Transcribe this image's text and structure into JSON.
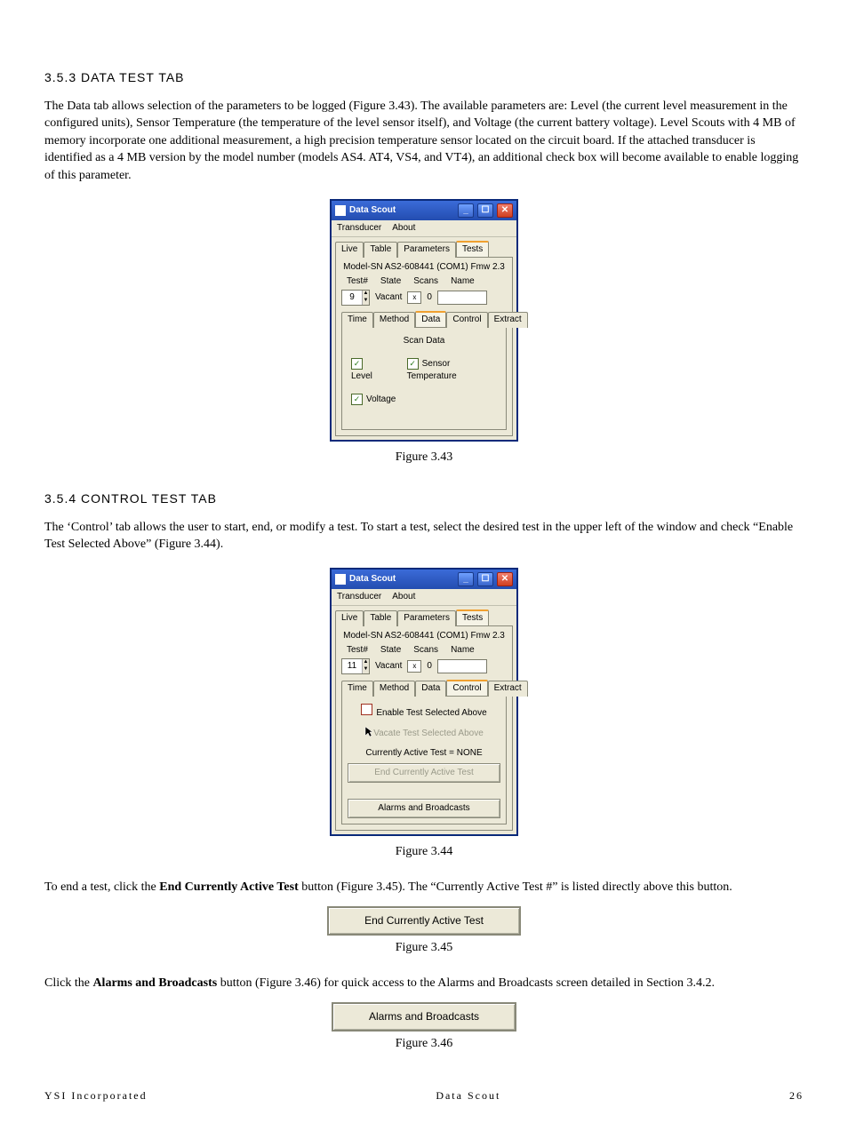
{
  "sections": {
    "s353": {
      "heading": "3.5.3 DATA TEST TAB",
      "para": "The Data tab allows selection of the parameters to be logged (Figure 3.43). The available parameters are: Level (the current level measurement in the configured units), Sensor Temperature (the temperature of the level sensor itself), and Voltage (the current battery voltage).  Level Scouts with 4 MB of memory incorporate one additional measurement, a high precision temperature sensor located on the circuit board. If the attached transducer is identified as a 4 MB version by the model number (models AS4. AT4, VS4, and VT4), an additional check box will become available to enable logging of this parameter."
    },
    "s354": {
      "heading": "3.5.4 CONTROL TEST TAB",
      "para": "The ‘Control’ tab allows the user to start, end, or modify a test.  To start a test, select the desired test in the upper left of the window and check “Enable Test Selected Above” (Figure 3.44).",
      "para2_a": "To end a test, click the ",
      "para2_b": "End Currently Active Test",
      "para2_c": " button (Figure 3.45).  The “Currently Active Test #” is listed directly above this button.",
      "para3_a": "Click the ",
      "para3_b": "Alarms and Broadcasts",
      "para3_c": " button (Figure 3.46) for quick access to the Alarms and Broadcasts screen detailed in Section 3.4.2."
    }
  },
  "captions": {
    "f343": "Figure 3.43",
    "f344": "Figure 3.44",
    "f345": "Figure 3.45",
    "f346": "Figure 3.46"
  },
  "win_common": {
    "title": "Data Scout",
    "menu_transducer": "Transducer",
    "menu_about": "About",
    "tabs_main": {
      "live": "Live",
      "table": "Table",
      "parameters": "Parameters",
      "tests": "Tests"
    },
    "model_line": "Model-SN AS2-608441 (COM1) Fmw 2.3",
    "headers": {
      "test": "Test#",
      "state": "State",
      "scans": "Scans",
      "name": "Name"
    },
    "state_vacant": "Vacant",
    "state_x": "x",
    "scans_zero": "0",
    "tabs_sub": {
      "time": "Time",
      "method": "Method",
      "data": "Data",
      "control": "Control",
      "extract": "Extract"
    }
  },
  "fig343": {
    "test_num": "9",
    "scan_data_label": "Scan Data",
    "cb_level": "Level",
    "cb_sensor_temp": "Sensor Temperature",
    "cb_voltage": "Voltage"
  },
  "fig344": {
    "test_num": "11",
    "enable_label": "Enable Test Selected Above",
    "vacate_label": "Vacate Test Selected Above",
    "active_label": "Currently Active Test = NONE",
    "end_btn": "End Currently Active Test",
    "alarms_btn": "Alarms and Broadcasts"
  },
  "fig345": {
    "btn": "End Currently Active Test"
  },
  "fig346": {
    "btn": "Alarms and Broadcasts"
  },
  "footer": {
    "left": "YSI Incorporated",
    "center": "Data Scout",
    "right": "26"
  }
}
